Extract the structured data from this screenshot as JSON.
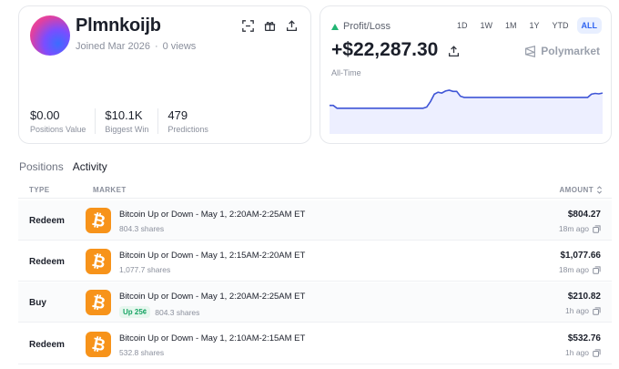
{
  "profile": {
    "username": "Plmnkoijb",
    "joined": "Joined Mar 2026",
    "views": "0 views",
    "stats": [
      {
        "value": "$0.00",
        "label": "Positions Value"
      },
      {
        "value": "$10.1K",
        "label": "Biggest Win"
      },
      {
        "value": "479",
        "label": "Predictions"
      }
    ],
    "icons": [
      "qr-scan-icon",
      "gift-icon",
      "share-icon"
    ]
  },
  "pnl": {
    "label": "Profit/Loss",
    "value": "+$22,287.30",
    "period": "All-Time",
    "brand": "Polymarket",
    "timeframes": [
      "1D",
      "1W",
      "1M",
      "1Y",
      "YTD",
      "ALL"
    ],
    "active_timeframe": "ALL",
    "line_color": "#3f55d6",
    "fill_color": "#e8ebff",
    "series": [
      0.62,
      0.62,
      0.55,
      0.55,
      0.55,
      0.55,
      0.55,
      0.55,
      0.55,
      0.55,
      0.55,
      0.55,
      0.55,
      0.55,
      0.55,
      0.55,
      0.55,
      0.55,
      0.55,
      0.55,
      0.55,
      0.55,
      0.55,
      0.55,
      0.55,
      0.55,
      0.58,
      0.72,
      0.9,
      0.95,
      0.93,
      0.98,
      1.0,
      0.97,
      0.97,
      0.85,
      0.82,
      0.82,
      0.82,
      0.82,
      0.82,
      0.82,
      0.82,
      0.82,
      0.82,
      0.82,
      0.82,
      0.82,
      0.82,
      0.82,
      0.82,
      0.82,
      0.82,
      0.82,
      0.82,
      0.82,
      0.82,
      0.82,
      0.82,
      0.82,
      0.82,
      0.82,
      0.82,
      0.82,
      0.82,
      0.82,
      0.82,
      0.82,
      0.82,
      0.82,
      0.9,
      0.92,
      0.91,
      0.93
    ]
  },
  "tabs": [
    {
      "label": "Positions",
      "active": false
    },
    {
      "label": "Activity",
      "active": true
    }
  ],
  "table": {
    "columns": {
      "type": "TYPE",
      "market": "MARKET",
      "amount": "AMOUNT"
    },
    "rows": [
      {
        "type": "Redeem",
        "title": "Bitcoin Up or Down - May 1, 2:20AM-2:25AM ET",
        "badge": "",
        "shares": "804.3 shares",
        "amount": "$804.27",
        "ago": "18m ago"
      },
      {
        "type": "Redeem",
        "title": "Bitcoin Up or Down - May 1, 2:15AM-2:20AM ET",
        "badge": "",
        "shares": "1,077.7 shares",
        "amount": "$1,077.66",
        "ago": "18m ago"
      },
      {
        "type": "Buy",
        "title": "Bitcoin Up or Down - May 1, 2:20AM-2:25AM ET",
        "badge": "Up 25¢",
        "shares": "804.3 shares",
        "amount": "$210.82",
        "ago": "1h ago"
      },
      {
        "type": "Redeem",
        "title": "Bitcoin Up or Down - May 1, 2:10AM-2:15AM ET",
        "badge": "",
        "shares": "532.8 shares",
        "amount": "$532.76",
        "ago": "1h ago"
      }
    ]
  }
}
